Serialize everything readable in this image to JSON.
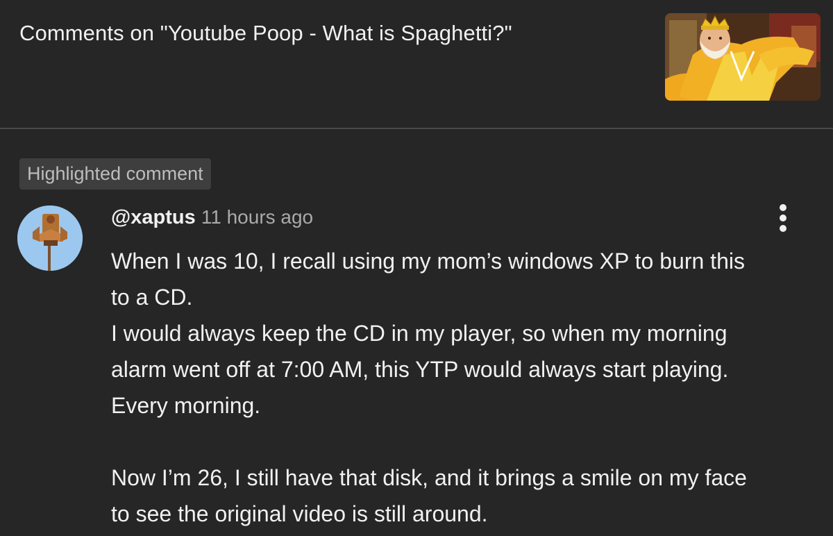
{
  "header": {
    "title": "Comments on \"Youtube Poop - What is Spaghetti?\""
  },
  "badge": {
    "label": "Highlighted comment"
  },
  "comment": {
    "handle": "@xaptus",
    "time": "11 hours ago",
    "lines": [
      "When I was 10, I recall using my mom’s windows XP to burn this",
      "to a CD.",
      "I would always keep the CD in my player, so when my morning",
      "alarm went off at 7:00 AM, this YTP would always start playing.",
      "Every morning.",
      "",
      "Now I’m 26, I still have that disk, and it brings a smile on my face",
      "to see the original video is still around."
    ]
  },
  "colors": {
    "background": "#262626",
    "text": "#f1f1f1",
    "secondary_text": "#aaaaaa",
    "badge_bg": "#3e3e3e"
  },
  "icons": {
    "menu": "vertical-dots-icon"
  }
}
